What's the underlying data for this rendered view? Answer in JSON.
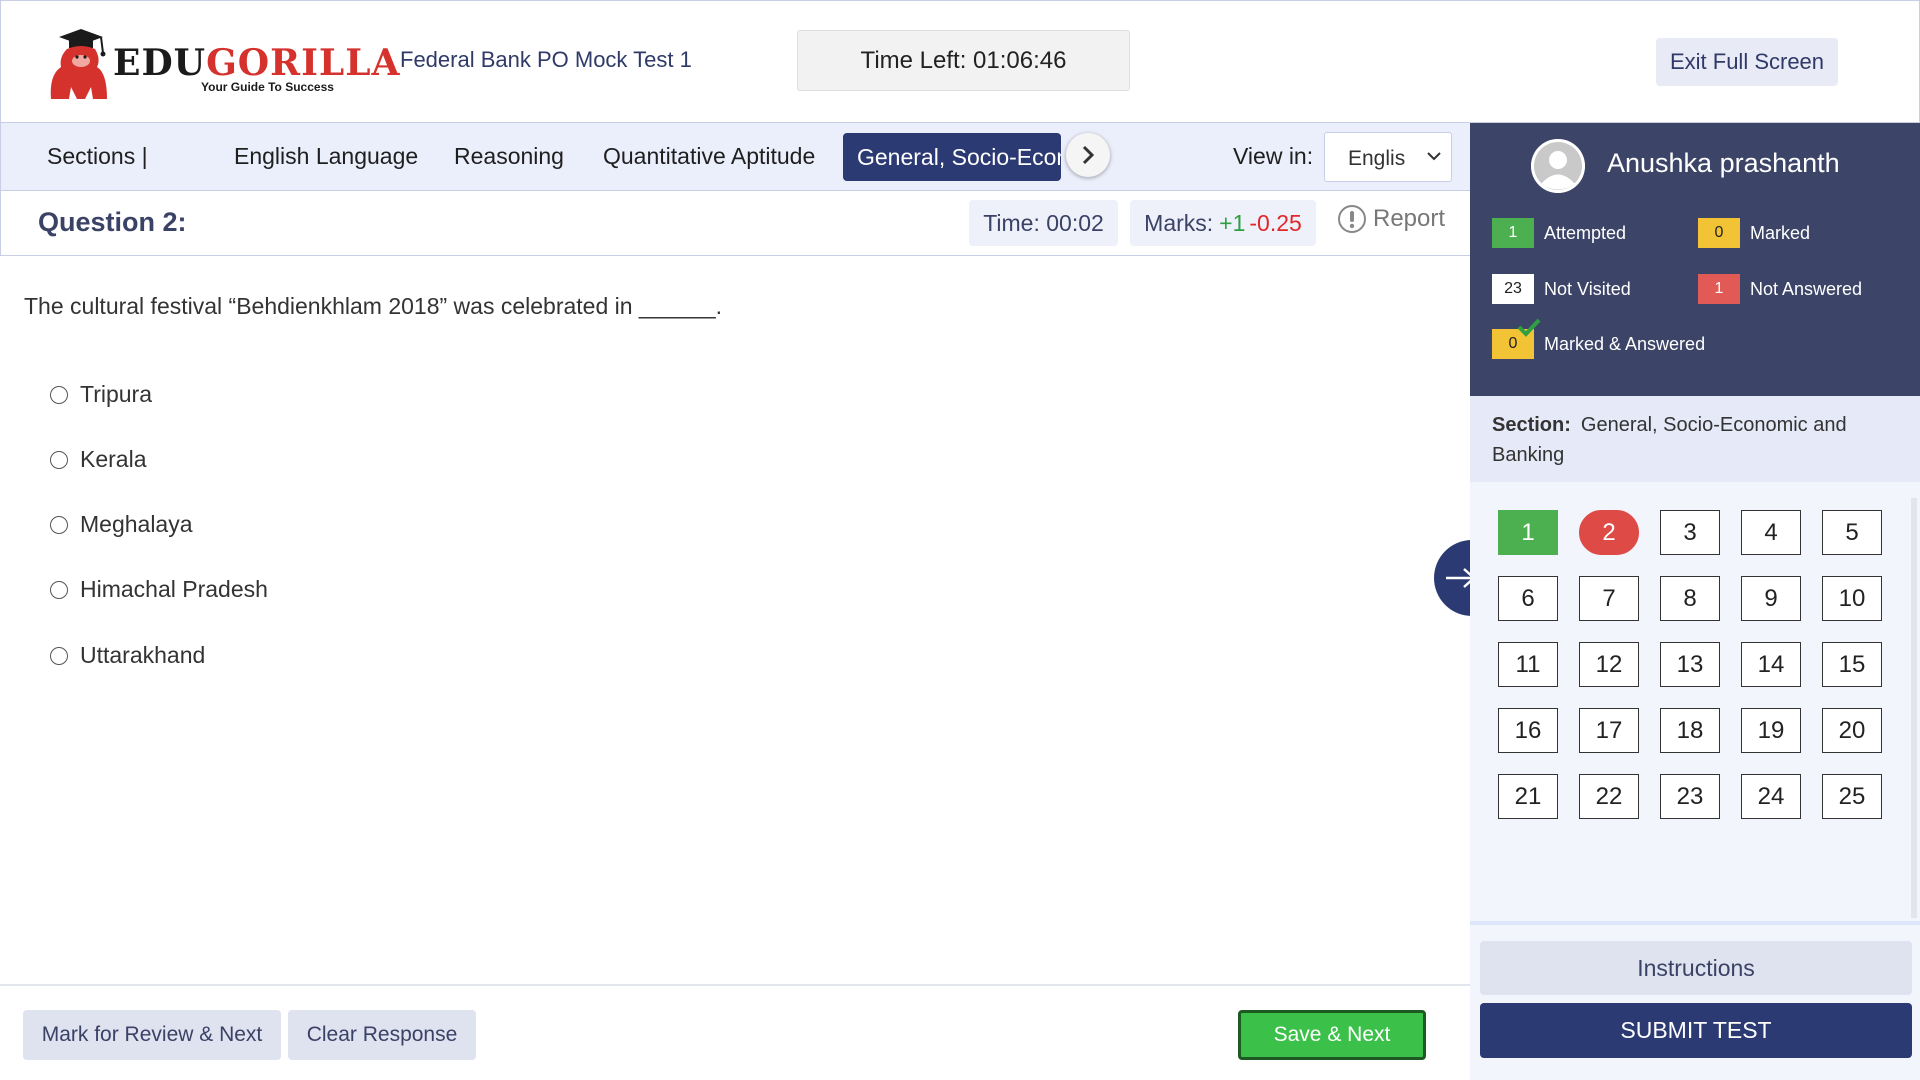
{
  "brand": {
    "name_dark": "EDU",
    "name_red": "GORILLA",
    "tagline": "Your Guide To Success"
  },
  "header": {
    "test_name": "Federal Bank PO Mock Test 1",
    "timer_label": "Time Left:",
    "timer_value": "01:06:46",
    "exit_label": "Exit Full Screen"
  },
  "sections": {
    "label": "Sections |",
    "tabs": [
      {
        "label": "English Language"
      },
      {
        "label": "Reasoning"
      },
      {
        "label": "Quantitative Aptitude"
      },
      {
        "label": "General, Socio-Economic and Banking",
        "active": true
      }
    ],
    "view_in_label": "View in:",
    "language": "Englis"
  },
  "question": {
    "title": "Question 2:",
    "time_label": "Time:",
    "time_value": "00:02",
    "marks_label": "Marks:",
    "marks_positive": "+1",
    "marks_negative": "-0.25",
    "report_label": "Report",
    "text": "The cultural festival “Behdienkhlam 2018” was celebrated in ______.",
    "options": [
      "Tripura",
      "Kerala",
      "Meghalaya",
      "Himachal Pradesh",
      "Uttarakhand"
    ]
  },
  "footer": {
    "mark_review": "Mark for Review & Next",
    "clear": "Clear Response",
    "save_next": "Save & Next"
  },
  "panel": {
    "user_name": "Anushka prashanth",
    "legend": {
      "attempted": {
        "count": "1",
        "label": "Attempted"
      },
      "marked": {
        "count": "0",
        "label": "Marked"
      },
      "not_visited": {
        "count": "23",
        "label": "Not Visited"
      },
      "not_answered": {
        "count": "1",
        "label": "Not Answered"
      },
      "marked_answered": {
        "count": "0",
        "label": "Marked & Answered"
      }
    },
    "section_label": "Section:",
    "section_name": "General, Socio-Economic and Banking",
    "questions": [
      {
        "n": "1",
        "status": "answered"
      },
      {
        "n": "2",
        "status": "not-answered"
      },
      {
        "n": "3",
        "status": "not-visited"
      },
      {
        "n": "4",
        "status": "not-visited"
      },
      {
        "n": "5",
        "status": "not-visited"
      },
      {
        "n": "6",
        "status": "not-visited"
      },
      {
        "n": "7",
        "status": "not-visited"
      },
      {
        "n": "8",
        "status": "not-visited"
      },
      {
        "n": "9",
        "status": "not-visited"
      },
      {
        "n": "10",
        "status": "not-visited"
      },
      {
        "n": "11",
        "status": "not-visited"
      },
      {
        "n": "12",
        "status": "not-visited"
      },
      {
        "n": "13",
        "status": "not-visited"
      },
      {
        "n": "14",
        "status": "not-visited"
      },
      {
        "n": "15",
        "status": "not-visited"
      },
      {
        "n": "16",
        "status": "not-visited"
      },
      {
        "n": "17",
        "status": "not-visited"
      },
      {
        "n": "18",
        "status": "not-visited"
      },
      {
        "n": "19",
        "status": "not-visited"
      },
      {
        "n": "20",
        "status": "not-visited"
      },
      {
        "n": "21",
        "status": "not-visited"
      },
      {
        "n": "22",
        "status": "not-visited"
      },
      {
        "n": "23",
        "status": "not-visited"
      },
      {
        "n": "24",
        "status": "not-visited"
      },
      {
        "n": "25",
        "status": "not-visited"
      }
    ],
    "instructions_label": "Instructions",
    "submit_label": "SUBMIT TEST"
  },
  "colors": {
    "navy": "#2b3a73",
    "panel_dark": "#3c4568",
    "answered_green": "#4caf50",
    "not_answered_red": "#de4a45",
    "marked_yellow": "#f2c335",
    "save_green": "#3bc14a"
  },
  "icons": [
    "gorilla-logo-icon",
    "chevron-right-icon",
    "chevron-down-icon",
    "report-icon",
    "avatar-icon",
    "arrow-right-icon",
    "checkmark-icon"
  ]
}
